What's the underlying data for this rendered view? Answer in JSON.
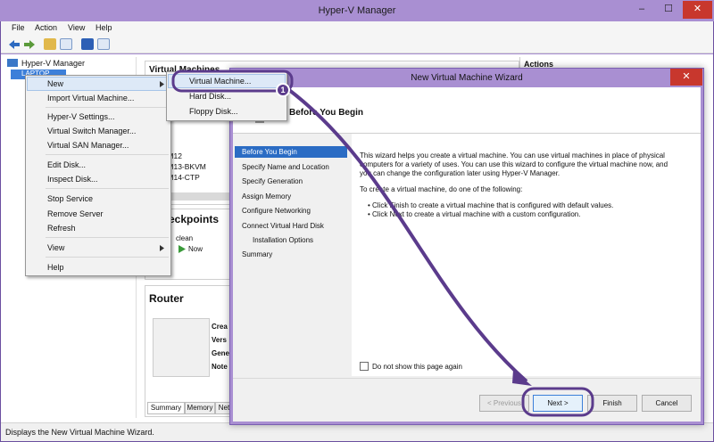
{
  "app": {
    "title": "Hyper-V Manager",
    "minimize": "–",
    "maximize": "☐",
    "close": "✕"
  },
  "menu": [
    "File",
    "Action",
    "View",
    "Help"
  ],
  "status": "Displays the New Virtual Machine Wizard.",
  "tree": {
    "root": "Hyper-V Manager",
    "server": "LAPTOP"
  },
  "panels": {
    "vm_header": "Virtual Machines",
    "vm_list": [
      "E",
      "ALM12",
      "ALM13-BKVM",
      "ALM14-CTP"
    ],
    "checkpoints_header": "Checkpoints",
    "checkpoint_clean": "clean",
    "checkpoint_now": "Now",
    "router_header": "Router",
    "router_fields": [
      "Crea",
      "Vers",
      "Gene",
      "Note"
    ],
    "router_tabs": [
      "Summary",
      "Memory",
      "Net"
    ],
    "actions_header": "Actions"
  },
  "context_menu": {
    "items": [
      "New",
      "Import Virtual Machine...",
      "Hyper-V Settings...",
      "Virtual Switch Manager...",
      "Virtual SAN Manager...",
      "Edit Disk...",
      "Inspect Disk...",
      "Stop Service",
      "Remove Server",
      "Refresh",
      "View",
      "Help"
    ],
    "submenu": [
      "Virtual Machine...",
      "Hard Disk...",
      "Floppy Disk..."
    ]
  },
  "wizard": {
    "title": "New Virtual Machine Wizard",
    "heading": "Before You Begin",
    "steps": [
      "Before You Begin",
      "Specify Name and Location",
      "Specify Generation",
      "Assign Memory",
      "Configure Networking",
      "Connect Virtual Hard Disk",
      "Installation Options",
      "Summary"
    ],
    "para1": [
      "This wizard helps you create a virtual machine. You can use virtual machines in place of physical",
      "computers for a variety of uses. You can use this wizard to configure the virtual machine now, and",
      "you can change the configuration later using Hyper-V Manager."
    ],
    "para2": "To create a virtual machine, do one of the following:",
    "bullets": [
      "• Click Finish to create a virtual machine that is configured with default values.",
      "• Click Next to create a virtual machine with a custom configuration."
    ],
    "checkbox_label": "Do not show this page again",
    "buttons": {
      "previous": "< Previous",
      "next": "Next >",
      "finish": "Finish",
      "cancel": "Cancel"
    }
  },
  "callout": {
    "number": "1"
  },
  "colors": {
    "accent": "#5b3b8c",
    "titlebar": "#a98fd2",
    "selection": "#2b6cc4",
    "close": "#c8372d"
  }
}
